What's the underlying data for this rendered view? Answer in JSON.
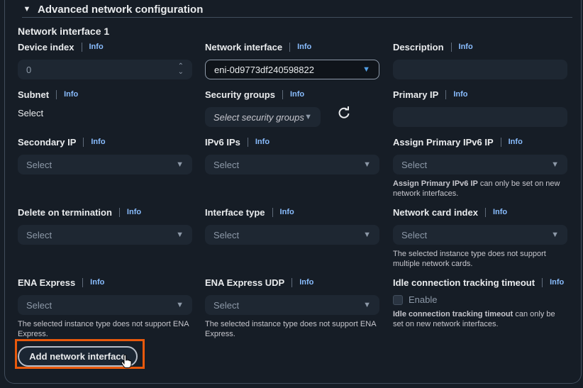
{
  "section": {
    "title": "Advanced network configuration"
  },
  "network_interface_title": "Network interface 1",
  "info_label": "Info",
  "fields": {
    "device_index": {
      "label": "Device index",
      "placeholder": "0"
    },
    "network_interface": {
      "label": "Network interface",
      "value": "eni-0d9773df240598822"
    },
    "description": {
      "label": "Description",
      "value": ""
    },
    "subnet": {
      "label": "Subnet",
      "value": "Select"
    },
    "security_groups": {
      "label": "Security groups",
      "placeholder": "Select security groups"
    },
    "primary_ip": {
      "label": "Primary IP",
      "value": ""
    },
    "secondary_ip": {
      "label": "Secondary IP",
      "placeholder": "Select"
    },
    "ipv6_ips": {
      "label": "IPv6 IPs",
      "placeholder": "Select"
    },
    "assign_primary_ipv6": {
      "label": "Assign Primary IPv6 IP",
      "placeholder": "Select",
      "help_bold": "Assign Primary IPv6 IP",
      "help_rest": " can only be set on new network interfaces."
    },
    "delete_on_termination": {
      "label": "Delete on termination",
      "placeholder": "Select"
    },
    "interface_type": {
      "label": "Interface type",
      "placeholder": "Select"
    },
    "network_card_index": {
      "label": "Network card index",
      "placeholder": "Select",
      "help": "The selected instance type does not support multiple network cards."
    },
    "ena_express": {
      "label": "ENA Express",
      "placeholder": "Select",
      "help": "The selected instance type does not support ENA Express."
    },
    "ena_express_udp": {
      "label": "ENA Express UDP",
      "placeholder": "Select",
      "help": "The selected instance type does not support ENA Express."
    },
    "idle_timeout": {
      "label": "Idle connection tracking timeout",
      "checkbox_label": "Enable",
      "help_bold": "Idle connection tracking timeout",
      "help_rest": " can only be set on new network interfaces."
    }
  },
  "add_button": {
    "label": "Add network interface"
  },
  "colors": {
    "highlight": "#e8590c",
    "info_link": "#89bdff",
    "background": "#161d26"
  }
}
